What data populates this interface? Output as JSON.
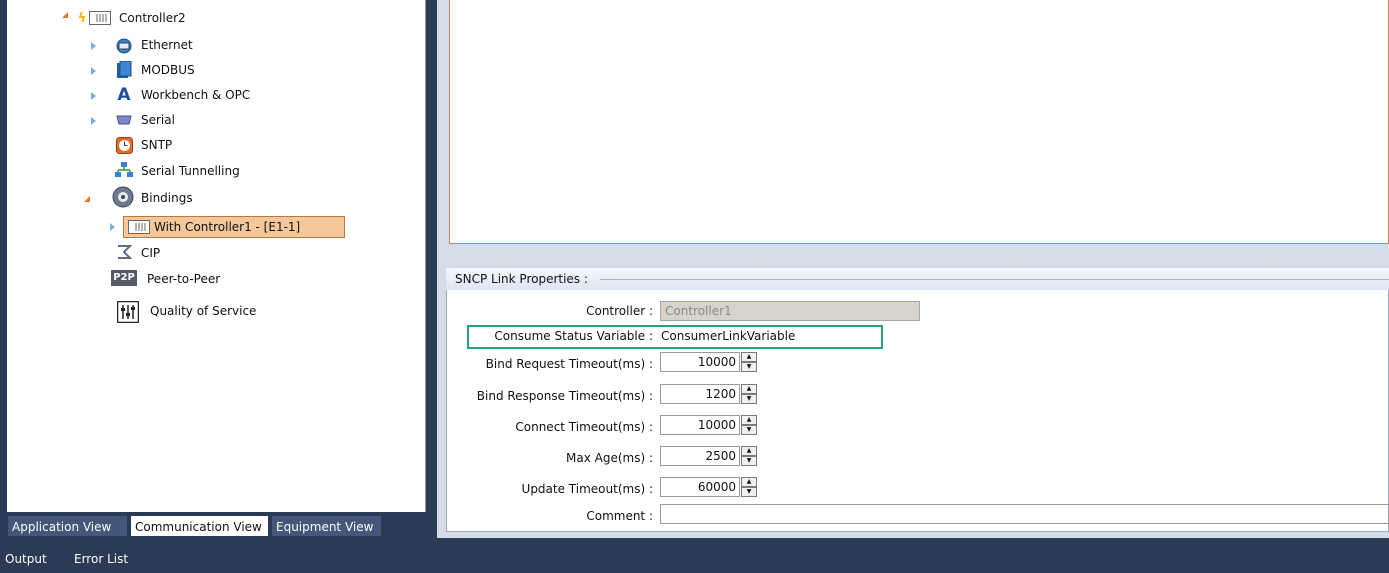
{
  "tree": {
    "root": {
      "label": "Controller2"
    },
    "items": [
      {
        "label": "Ethernet"
      },
      {
        "label": "MODBUS"
      },
      {
        "label": "Workbench & OPC"
      },
      {
        "label": "Serial"
      },
      {
        "label": "SNTP"
      },
      {
        "label": "Serial Tunnelling"
      },
      {
        "label": "Bindings"
      },
      {
        "label": "With Controller1 - [E1-1]"
      },
      {
        "label": "CIP"
      },
      {
        "label": "Peer-to-Peer"
      },
      {
        "label": "Quality of Service"
      }
    ]
  },
  "view_tabs": [
    {
      "label": "Application View"
    },
    {
      "label": "Communication View",
      "active": true
    },
    {
      "label": "Equipment View"
    }
  ],
  "status_bar": {
    "output": "Output",
    "error_list": "Error List"
  },
  "properties": {
    "title": "SNCP Link Properties :",
    "controller": {
      "label": "Controller :",
      "value": "Controller1"
    },
    "consume_status": {
      "label": "Consume Status Variable :",
      "value": "ConsumerLinkVariable"
    },
    "bind_request_timeout": {
      "label": "Bind Request Timeout(ms) :",
      "value": "10000"
    },
    "bind_response_timeout": {
      "label": "Bind Response Timeout(ms) :",
      "value": "1200"
    },
    "connect_timeout": {
      "label": "Connect Timeout(ms) :",
      "value": "10000"
    },
    "max_age": {
      "label": "Max Age(ms) :",
      "value": "2500"
    },
    "update_timeout": {
      "label": "Update Timeout(ms) :",
      "value": "60000"
    },
    "comment": {
      "label": "Comment :",
      "value": ""
    }
  },
  "colors": {
    "background": "#2b3a55",
    "selection": "#f5c89b",
    "highlight_box": "#1fa37f"
  },
  "icons": {
    "root": "controller-lightning-icon",
    "ethernet": "ethernet-globe-icon",
    "modbus": "modbus-book-icon",
    "workbench": "workbench-a-icon",
    "serial": "serial-port-icon",
    "sntp": "sntp-clock-icon",
    "serial_tunnelling": "network-icon",
    "bindings": "bindings-gear-icon",
    "binding_node": "controller-icon",
    "cip": "cip-icon",
    "p2p": "p2p-icon",
    "qos": "qos-icon"
  }
}
